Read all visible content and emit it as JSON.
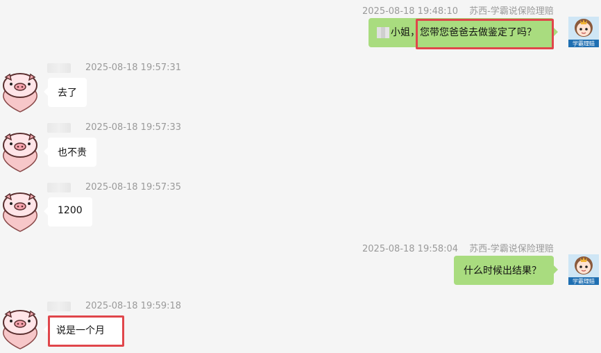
{
  "messages": [
    {
      "side": "out",
      "time": "2025-08-18 19:48:10",
      "sender": "苏西-学霸说保险理赔",
      "name_blurred": "",
      "text_prefix": "小姐，",
      "text_main": "您带您爸爸去做鉴定了吗？",
      "highlighted": true
    },
    {
      "side": "in",
      "time": "2025-08-18 19:57:31",
      "text": "去了",
      "highlighted": false
    },
    {
      "side": "in",
      "time": "2025-08-18 19:57:33",
      "text": "也不贵",
      "highlighted": false
    },
    {
      "side": "in",
      "time": "2025-08-18 19:57:35",
      "text": "1200",
      "highlighted": false
    },
    {
      "side": "out",
      "time": "2025-08-18 19:58:04",
      "sender": "苏西-学霸说保险理赔",
      "text": "什么时候出结果？",
      "highlighted": false
    },
    {
      "side": "in",
      "time": "2025-08-18 19:59:18",
      "text": "说是一个月",
      "highlighted": true
    }
  ],
  "avatar_caption": "学霸理赔",
  "colors": {
    "outgoing_bubble": "#a9dc7f",
    "incoming_bubble": "#ffffff",
    "highlight": "#e0464b",
    "background": "#f5f5f5"
  },
  "icons": {
    "incoming_avatar": "pig-heart-icon",
    "outgoing_avatar": "girl-avatar-icon"
  }
}
